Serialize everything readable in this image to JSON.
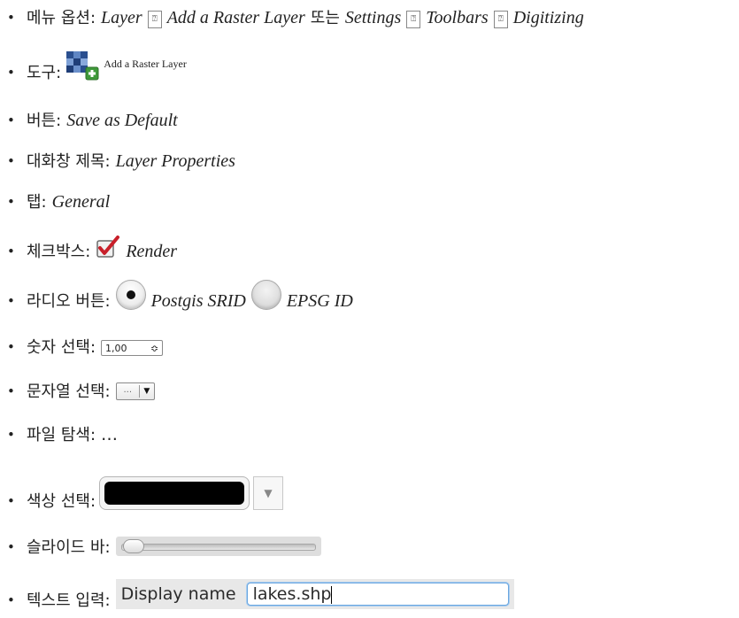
{
  "items": [
    {
      "label": "메뉴 옵션:",
      "parts": [
        "Layer",
        "Add a Raster Layer",
        "또는",
        "Settings",
        "Toolbars",
        "Digitizing"
      ],
      "separator": "⍰"
    },
    {
      "label": "도구:",
      "tool_text": "Add a Raster Layer"
    },
    {
      "label": "버튼:",
      "value": "Save as Default"
    },
    {
      "label": "대화창 제목:",
      "value": "Layer Properties"
    },
    {
      "label": "탭:",
      "value": "General"
    },
    {
      "label": "체크박스:",
      "value": "Render"
    },
    {
      "label": "라디오 버튼:",
      "radio1": "Postgis SRID",
      "radio2": "EPSG ID"
    },
    {
      "label": "숫자 선택:",
      "spin_value": "1,00",
      "spin_arrows": "≎"
    },
    {
      "label": "문자열 선택:",
      "dots": "...",
      "arrow": "▼"
    },
    {
      "label": "파일 탐색:",
      "value": "…"
    },
    {
      "label": "색상 선택:",
      "color": "#000000",
      "drop_arrow": "▼"
    },
    {
      "label": "슬라이드 바:",
      "level": 0.0
    },
    {
      "label": "텍스트 입력:",
      "field_label": "Display name",
      "field_value": "lakes.shp"
    }
  ],
  "bullet": "•"
}
